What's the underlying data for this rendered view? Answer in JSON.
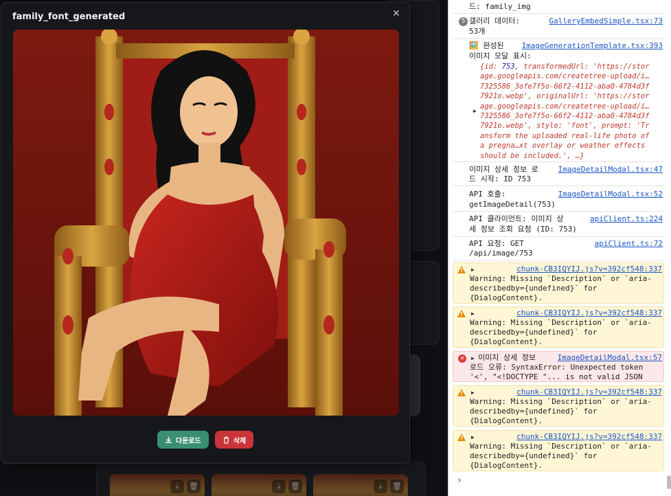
{
  "modal": {
    "title": "family_font_generated",
    "close_icon": "close-icon",
    "image_alt": "illustration of a pregnant woman in a red dress seated on an ornate golden throne",
    "download_label": "다운로드",
    "delete_label": "삭제"
  },
  "colors": {
    "download": "#3a8f72",
    "delete": "#c9353a",
    "link": "#1a55c7",
    "warning_bg": "#fef6d5",
    "error_bg": "#fce8e8"
  },
  "console": {
    "messages": [
      {
        "level": "log",
        "lines": [
          "드: family_img"
        ]
      },
      {
        "level": "log",
        "count": "5",
        "lines": [
          "갤러리 데이터:",
          "53개"
        ],
        "source": "GalleryEmbedSimple.tsx:73"
      },
      {
        "level": "log",
        "lines": [
          "🖼️ 완성된",
          "이미지 모달 표시:"
        ],
        "source": "ImageGenerationTemplate.tsx:393",
        "object": {
          "prefix": "{id: ",
          "id": "753",
          "rest": ", transformedUrl: 'https://storage.googleapis.com/createtree-upload/i…7325586_3ofe7f5o-66f2-4112-aba0-4784d3f7921o.webp', originalUrl: 'https://storage.googleapis.com/createtree-upload/i…7325586_3ofe7f5o-66f2-4112-aba0-4784d3f7921o.webp', style: 'font', prompt: 'Transform the uploaded real-life photo of a pregna…xt overlay or weather effects should be included.', …}"
        }
      },
      {
        "level": "log",
        "lines": [
          "이미지 상세 정보 로",
          "드 시작: ID 753"
        ],
        "source": "ImageDetailModal.tsx:47"
      },
      {
        "level": "log",
        "lines": [
          "API 호출:",
          "getImageDetail(753)"
        ],
        "source": "ImageDetailModal.tsx:52"
      },
      {
        "level": "log",
        "lines": [
          "API 클라이언트: 이미지 상",
          "세 정보 조회 요청 (ID: 753)"
        ],
        "source": "apiClient.ts:224"
      },
      {
        "level": "log",
        "lines": [
          "API 요청: GET",
          "/api/image/753"
        ],
        "source": "apiClient.ts:72"
      },
      {
        "level": "warning",
        "lines": [
          "Warning: Missing `Description` or `aria-",
          "describedby={undefined}` for",
          "{DialogContent}."
        ],
        "source": "chunk-CB3IQYIJ.js?v=392cf548:337"
      },
      {
        "level": "warning",
        "lines": [
          "Warning: Missing `Description` or `aria-",
          "describedby={undefined}` for",
          "{DialogContent}."
        ],
        "source": "chunk-CB3IQYIJ.js?v=392cf548:337"
      },
      {
        "level": "error",
        "lines": [
          "이미지 상세 정보",
          "로드 오류: SyntaxError: Unexpected token",
          "'<', \"<!DOCTYPE \"... is not valid JSON"
        ],
        "source": "ImageDetailModal.tsx:57"
      },
      {
        "level": "warning",
        "lines": [
          "Warning: Missing `Description` or `aria-",
          "describedby={undefined}` for",
          "{DialogContent}."
        ],
        "source": "chunk-CB3IQYIJ.js?v=392cf548:337"
      },
      {
        "level": "warning",
        "lines": [
          "Warning: Missing `Description` or `aria-",
          "describedby={undefined}` for",
          "{DialogContent}."
        ],
        "source": "chunk-CB3IQYIJ.js?v=392cf548:337"
      }
    ],
    "prompt_symbol": "›"
  }
}
